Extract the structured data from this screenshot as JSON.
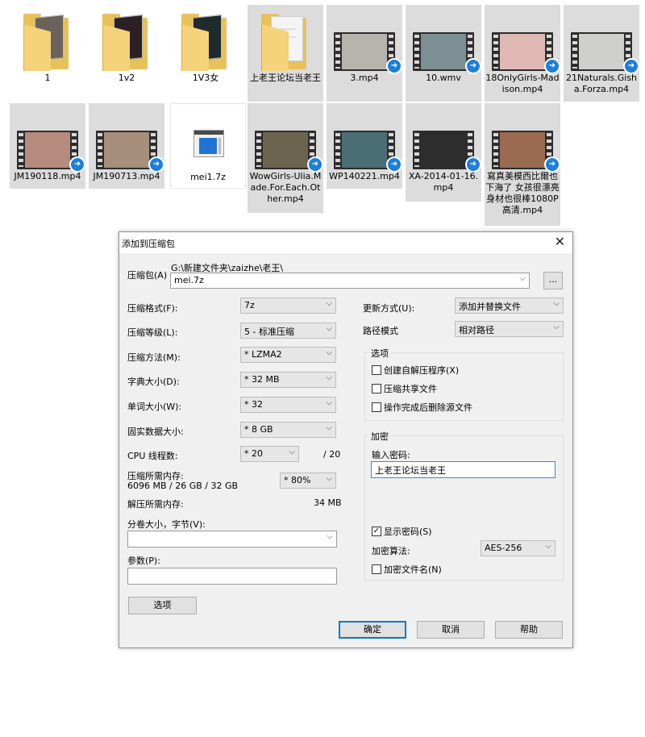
{
  "files": [
    {
      "name": "1",
      "type": "folder",
      "photo": "#6b625c"
    },
    {
      "name": "1v2",
      "type": "folder",
      "photo": "#2b2124"
    },
    {
      "name": "1V3女",
      "type": "folder",
      "photo": "#1f2a2d"
    },
    {
      "name": "上老王论坛当老王",
      "type": "folder-paper"
    },
    {
      "name": "3.mp4",
      "type": "video",
      "thumb": "#b7b4ae"
    },
    {
      "name": "10.wmv",
      "type": "video",
      "thumb": "#7c8f93"
    },
    {
      "name": "18OnlyGirls-Madison.mp4",
      "type": "video",
      "thumb": "#e0b9b4"
    },
    {
      "name": "21Naturals.Gisha.Forza.mp4",
      "type": "video",
      "thumb": "#cfcfcd"
    },
    {
      "name": "JM190118.mp4",
      "type": "video",
      "thumb": "#b48b7c"
    },
    {
      "name": "JM190713.mp4",
      "type": "video",
      "thumb": "#a88f7b"
    },
    {
      "name": "mei1.7z",
      "type": "archive"
    },
    {
      "name": "WowGirls-Ulia.Made.For.Each.Other.mp4",
      "type": "video",
      "thumb": "#6d6450"
    },
    {
      "name": "WP140221.mp4",
      "type": "video",
      "thumb": "#4b6d74"
    },
    {
      "name": "XA-2014-01-16.mp4",
      "type": "video",
      "thumb": "#2d2d2d"
    },
    {
      "name": "寫真美模西比爾也下海了 女孩很漂亮身材也很棒1080P高清.mp4",
      "type": "video",
      "thumb": "#9b6a50"
    }
  ],
  "dialog": {
    "title": "添加到压缩包",
    "archive_label": "压缩包(A)",
    "archive_path": "G:\\新建文件夹\\zaizhe\\老王\\",
    "archive_name": "mei.7z",
    "browse": "...",
    "format_label": "压缩格式(F):",
    "format_value": "7z",
    "level_label": "压缩等级(L):",
    "level_value": "5 - 标准压缩",
    "method_label": "压缩方法(M):",
    "method_value": "* LZMA2",
    "dict_label": "字典大小(D):",
    "dict_value": "* 32 MB",
    "word_label": "单词大小(W):",
    "word_value": "* 32",
    "solid_label": "固实数据大小:",
    "solid_value": "* 8 GB",
    "cpu_label": "CPU 线程数:",
    "cpu_value": "* 20",
    "cpu_max": "/ 20",
    "mem_label": "压缩所需内存:",
    "mem_detail": "6096 MB / 26 GB / 32 GB",
    "mem_value": "* 80%",
    "decomp_label": "解压所需内存:",
    "decomp_value": "34 MB",
    "split_label": "分卷大小，字节(V):",
    "split_value": "",
    "params_label": "参数(P):",
    "params_value": "",
    "options_btn": "选项",
    "update_label": "更新方式(U):",
    "update_value": "添加并替换文件",
    "path_label": "路径模式",
    "path_value": "相对路径",
    "options_group": "选项",
    "opt_sfx": "创建自解压程序(X)",
    "opt_shared": "压缩共享文件",
    "opt_delete": "操作完成后删除源文件",
    "enc_group": "加密",
    "pwd_label": "输入密码:",
    "pwd_value": "上老王论坛当老王",
    "show_pwd": "显示密码(S)",
    "enc_method_label": "加密算法:",
    "enc_method_value": "AES-256",
    "enc_names": "加密文件名(N)",
    "ok": "确定",
    "cancel": "取消",
    "help": "帮助"
  }
}
